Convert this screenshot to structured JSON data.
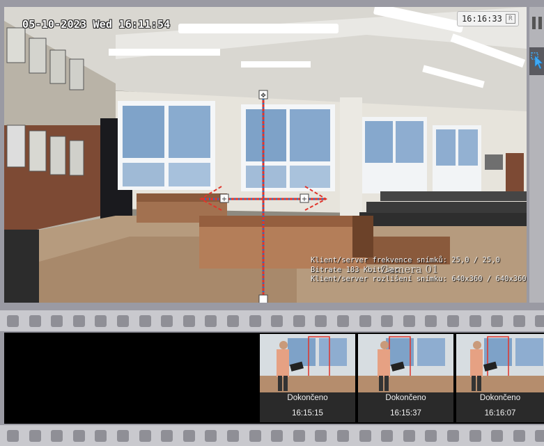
{
  "camera": {
    "osd_datetime": "05-10-2023 Wed 16:11:54",
    "current_time": "16:16:33",
    "rec_indicator": "R",
    "name": "Camera 01",
    "stats": [
      "Klient/server frekvence snímků: 25,0 / 25,0",
      "Bitrate 183 Kbit/sec",
      "Klient/server rozlišení snímku: 640x360 / 640x360"
    ]
  },
  "toolbar": {
    "pause_icon": "pause-icon",
    "select_icon": "select-area-icon"
  },
  "frames": [
    {
      "status": "Dokončeno",
      "time": "16:15:15"
    },
    {
      "status": "Dokončeno",
      "time": "16:15:37"
    },
    {
      "status": "Dokončeno",
      "time": "16:16:07"
    }
  ],
  "colors": {
    "overlay_red": "#e0342b",
    "overlay_blue": "#2f6fb8",
    "frame_bg": "#000000",
    "strip": "#c9c9ce"
  }
}
